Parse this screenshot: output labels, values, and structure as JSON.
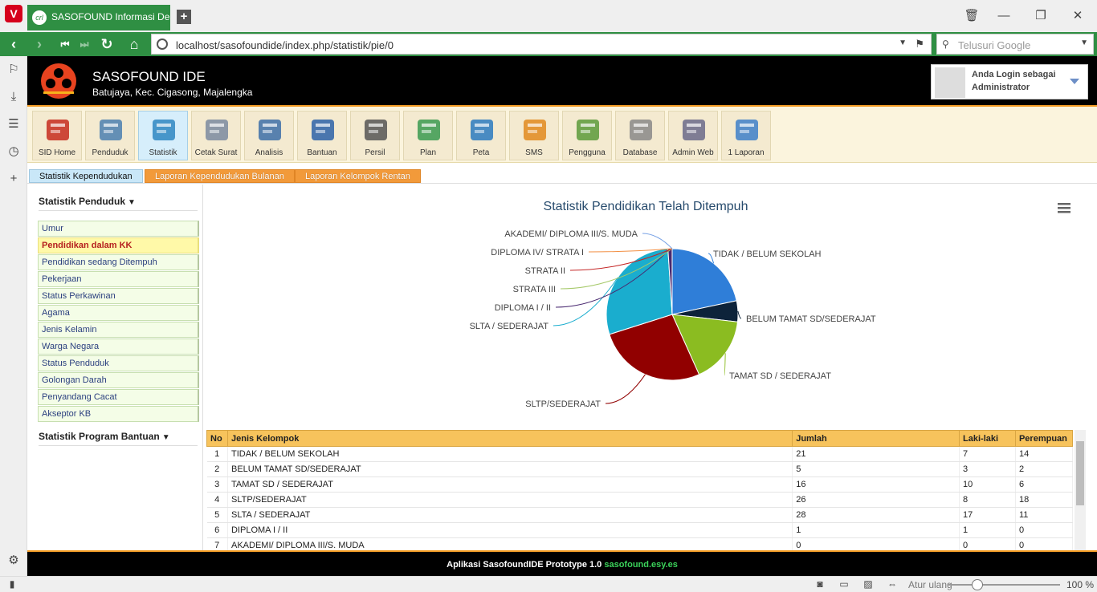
{
  "browser": {
    "tab_title": "SASOFOUND Informasi Desa",
    "url": "localhost/sasofoundide/index.php/statistik/pie/0",
    "search_placeholder": "Telusuri Google",
    "zoom_label": "Atur ulang",
    "zoom_value": "100 %"
  },
  "header": {
    "title": "SASOFOUND IDE",
    "subtitle": "Batujaya, Kec. Cigasong, Majalengka",
    "login_line1": "Anda Login sebagai",
    "login_line2": "Administrator"
  },
  "toolbar": [
    {
      "label": "SID Home",
      "icon": "home-icon"
    },
    {
      "label": "Penduduk",
      "icon": "residents-icon"
    },
    {
      "label": "Statistik",
      "icon": "statistics-icon"
    },
    {
      "label": "Cetak Surat",
      "icon": "print-letter-icon"
    },
    {
      "label": "Analisis",
      "icon": "analysis-icon"
    },
    {
      "label": "Bantuan",
      "icon": "help-icon"
    },
    {
      "label": "Persil",
      "icon": "parcel-map-icon"
    },
    {
      "label": "Plan",
      "icon": "plan-icon"
    },
    {
      "label": "Peta",
      "icon": "globe-icon"
    },
    {
      "label": "SMS",
      "icon": "sms-icon"
    },
    {
      "label": "Pengguna",
      "icon": "users-icon"
    },
    {
      "label": "Database",
      "icon": "database-icon"
    },
    {
      "label": "Admin Web",
      "icon": "admin-web-icon"
    },
    {
      "label": "1 Laporan",
      "icon": "report-mail-icon"
    }
  ],
  "subtabs": [
    "Statistik Kependudukan",
    "Laporan Kependudukan Bulanan",
    "Laporan Kelompok Rentan"
  ],
  "sidebar": {
    "section1": "Statistik Penduduk",
    "items": [
      "Umur",
      "Pendidikan dalam KK",
      "Pendidikan sedang Ditempuh",
      "Pekerjaan",
      "Status Perkawinan",
      "Agama",
      "Jenis Kelamin",
      "Warga Negara",
      "Status Penduduk",
      "Golongan Darah",
      "Penyandang Cacat",
      "Akseptor KB"
    ],
    "selected_index": 1,
    "section2": "Statistik Program Bantuan"
  },
  "chart_data": {
    "type": "pie",
    "title": "Statistik Pendidikan Telah Ditempuh",
    "slices": [
      {
        "label": "TIDAK / BELUM SEKOLAH",
        "value": 21,
        "color": "#2f7ed8"
      },
      {
        "label": "BELUM TAMAT SD/SEDERAJAT",
        "value": 5,
        "color": "#0d233a"
      },
      {
        "label": "TAMAT SD / SEDERAJAT",
        "value": 16,
        "color": "#8bbc21"
      },
      {
        "label": "SLTP/SEDERAJAT",
        "value": 26,
        "color": "#910000"
      },
      {
        "label": "SLTA / SEDERAJAT",
        "value": 28,
        "color": "#1aadce"
      },
      {
        "label": "DIPLOMA I / II",
        "value": 1,
        "color": "#492970"
      },
      {
        "label": "STRATA III",
        "value": 0,
        "color": "#a6c96a"
      },
      {
        "label": "STRATA II",
        "value": 0,
        "color": "#c42525"
      },
      {
        "label": "DIPLOMA IV/ STRATA I",
        "value": 0,
        "color": "#f28f43"
      },
      {
        "label": "AKADEMI/ DIPLOMA III/S. MUDA",
        "value": 0,
        "color": "#77a1e5"
      }
    ]
  },
  "table": {
    "headers": [
      "No",
      "Jenis Kelompok",
      "Jumlah",
      "Laki-laki",
      "Perempuan"
    ],
    "rows": [
      [
        "1",
        "TIDAK / BELUM SEKOLAH",
        "21",
        "7",
        "14"
      ],
      [
        "2",
        "BELUM TAMAT SD/SEDERAJAT",
        "5",
        "3",
        "2"
      ],
      [
        "3",
        "TAMAT SD / SEDERAJAT",
        "16",
        "10",
        "6"
      ],
      [
        "4",
        "SLTP/SEDERAJAT",
        "26",
        "8",
        "18"
      ],
      [
        "5",
        "SLTA / SEDERAJAT",
        "28",
        "17",
        "11"
      ],
      [
        "6",
        "DIPLOMA I / II",
        "1",
        "1",
        "0"
      ],
      [
        "7",
        "AKADEMI/ DIPLOMA III/S. MUDA",
        "0",
        "0",
        "0"
      ]
    ]
  },
  "footer": {
    "text": "Aplikasi SasofoundIDE Prototype 1.0",
    "link": "sasofound.esy.es"
  }
}
